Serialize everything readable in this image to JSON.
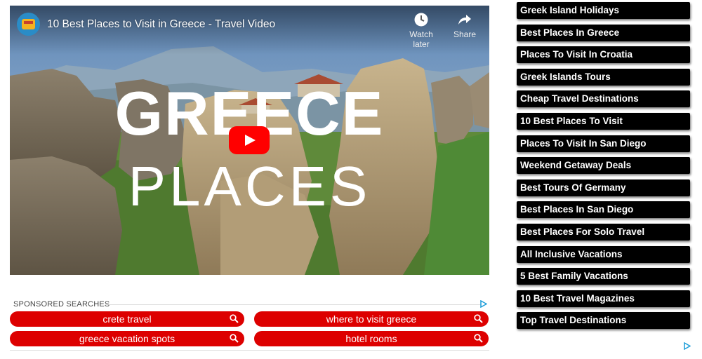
{
  "video": {
    "title": "10 Best Places to Visit in Greece - Travel Video",
    "overlay_line1": "GREECE",
    "overlay_line2": "PLACES",
    "watch_later_label": "Watch later",
    "share_label": "Share",
    "play_color": "#ff0000"
  },
  "sponsored": {
    "heading": "SPONSORED SEARCHES",
    "searches": [
      "crete travel",
      "where to visit greece",
      "greece vacation spots",
      "hotel rooms"
    ],
    "pill_color": "#dd0000"
  },
  "links": [
    "Greek Island Holidays",
    "Best Places In Greece",
    "Places To Visit In Croatia",
    "Greek Islands Tours",
    "Cheap Travel Destinations",
    "10 Best Places To Visit",
    "Places To Visit In San Diego",
    "Weekend Getaway Deals",
    "Best Tours Of Germany",
    "Best Places In San Diego",
    "Best Places For Solo Travel",
    "All Inclusive Vacations",
    "5 Best Family Vacations",
    "10 Best Travel Magazines",
    "Top Travel Destinations"
  ],
  "icons": {
    "watch_later": "clock-icon",
    "share": "share-arrow-icon",
    "search": "search-icon",
    "ad_choices": "ad-choices-icon",
    "play": "play-icon"
  }
}
